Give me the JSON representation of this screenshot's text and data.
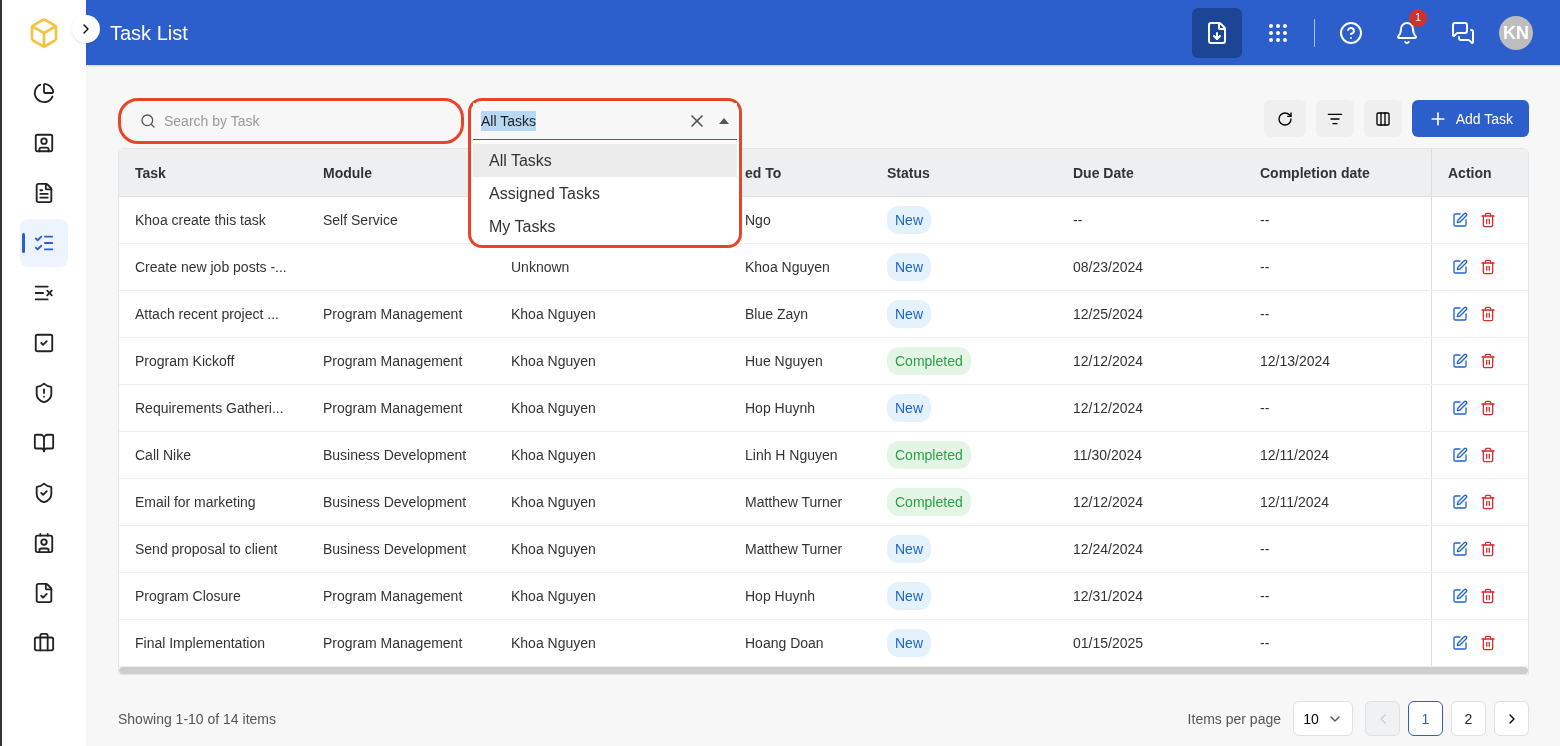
{
  "header": {
    "title": "Task List",
    "notification_count": "1",
    "avatar_initials": "KN"
  },
  "sidebar": {
    "items": [
      {
        "selected": false
      },
      {
        "selected": false
      },
      {
        "selected": false
      },
      {
        "selected": true
      },
      {
        "selected": false
      },
      {
        "selected": false
      },
      {
        "selected": false
      },
      {
        "selected": false
      },
      {
        "selected": false
      },
      {
        "selected": false
      },
      {
        "selected": false
      },
      {
        "selected": false
      }
    ]
  },
  "search": {
    "placeholder": "Search by Task",
    "highlighted": true
  },
  "task_filter": {
    "value": "All Tasks",
    "expanded": true,
    "highlighted": true,
    "options": [
      {
        "label": "All Tasks",
        "selected": true
      },
      {
        "label": "Assigned Tasks",
        "selected": false
      },
      {
        "label": "My Tasks",
        "selected": false
      }
    ]
  },
  "add_button": "Add Task",
  "table": {
    "columns": [
      "Task",
      "Module",
      null,
      "ed To",
      "Status",
      "Due Date",
      "Completion date",
      "Action"
    ],
    "rows": [
      {
        "task": "Khoa create this task",
        "module": "Self Service",
        "column_4": "Ngo",
        "status": {
          "label": "New",
          "kind": "new"
        },
        "due_date": "--",
        "completion_date": "--"
      },
      {
        "task": "Create new job posts -...",
        "column_3": "Unknown",
        "column_4": "Khoa Nguyen",
        "status": {
          "label": "New",
          "kind": "new"
        },
        "due_date": "08/23/2024",
        "completion_date": "--"
      },
      {
        "task": "Attach recent project ...",
        "module": "Program Management",
        "column_3": "Khoa Nguyen",
        "column_4": "Blue Zayn",
        "status": {
          "label": "New",
          "kind": "new"
        },
        "due_date": "12/25/2024",
        "completion_date": "--"
      },
      {
        "task": "Program Kickoff",
        "module": "Program Management",
        "column_3": "Khoa Nguyen",
        "column_4": "Hue Nguyen",
        "status": {
          "label": "Completed",
          "kind": "completed"
        },
        "due_date": "12/12/2024",
        "completion_date": "12/13/2024"
      },
      {
        "task": "Requirements Gatheri...",
        "module": "Program Management",
        "column_3": "Khoa Nguyen",
        "column_4": "Hop Huynh",
        "status": {
          "label": "New",
          "kind": "new"
        },
        "due_date": "12/12/2024",
        "completion_date": "--"
      },
      {
        "task": "Call Nike",
        "module": "Business Development",
        "column_3": "Khoa Nguyen",
        "column_4": "Linh H Nguyen",
        "status": {
          "label": "Completed",
          "kind": "completed"
        },
        "due_date": "11/30/2024",
        "completion_date": "12/11/2024"
      },
      {
        "task": "Email for marketing",
        "module": "Business Development",
        "column_3": "Khoa Nguyen",
        "column_4": "Matthew Turner",
        "status": {
          "label": "Completed",
          "kind": "completed"
        },
        "due_date": "12/12/2024",
        "completion_date": "12/11/2024"
      },
      {
        "task": "Send proposal to client",
        "module": "Business Development",
        "column_3": "Khoa Nguyen",
        "column_4": "Matthew Turner",
        "status": {
          "label": "New",
          "kind": "new"
        },
        "due_date": "12/24/2024",
        "completion_date": "--"
      },
      {
        "task": "Program Closure",
        "module": "Program Management",
        "column_3": "Khoa Nguyen",
        "column_4": "Hop Huynh",
        "status": {
          "label": "New",
          "kind": "new"
        },
        "due_date": "12/31/2024",
        "completion_date": "--"
      },
      {
        "task": "Final Implementation",
        "module": "Program Management",
        "column_3": "Khoa Nguyen",
        "column_4": "Hoang Doan",
        "status": {
          "label": "New",
          "kind": "new"
        },
        "due_date": "01/15/2025",
        "completion_date": "--"
      }
    ]
  },
  "footer": {
    "summary": "Showing 1-10 of 14 items",
    "per_page_label": "Items per page",
    "per_page_value": "10",
    "prev_disabled": true,
    "pages": [
      {
        "label": "1",
        "selected": true
      },
      {
        "label": "2",
        "selected": false
      }
    ]
  }
}
